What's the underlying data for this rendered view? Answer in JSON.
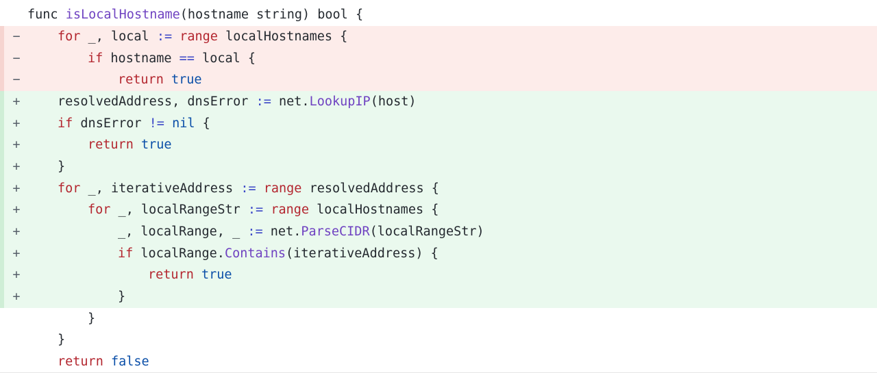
{
  "diff": {
    "lines": [
      {
        "type": "context",
        "marker": "",
        "indent": 0,
        "tokens": [
          {
            "t": "func ",
            "c": "plain"
          },
          {
            "t": "isLocalHostname",
            "c": "fn"
          },
          {
            "t": "(hostname string) bool {",
            "c": "plain"
          }
        ]
      },
      {
        "type": "removed",
        "marker": "−",
        "indent": 1,
        "tokens": [
          {
            "t": "for",
            "c": "kw"
          },
          {
            "t": " _, local ",
            "c": "plain"
          },
          {
            "t": ":=",
            "c": "op"
          },
          {
            "t": " ",
            "c": "plain"
          },
          {
            "t": "range",
            "c": "kw"
          },
          {
            "t": " localHostnames {",
            "c": "plain"
          }
        ]
      },
      {
        "type": "removed",
        "marker": "−",
        "indent": 2,
        "tokens": [
          {
            "t": "if",
            "c": "kw"
          },
          {
            "t": " hostname ",
            "c": "plain"
          },
          {
            "t": "==",
            "c": "op"
          },
          {
            "t": " local {",
            "c": "plain"
          }
        ]
      },
      {
        "type": "removed",
        "marker": "−",
        "indent": 3,
        "tokens": [
          {
            "t": "return",
            "c": "kw"
          },
          {
            "t": " ",
            "c": "plain"
          },
          {
            "t": "true",
            "c": "lit"
          }
        ]
      },
      {
        "type": "added",
        "marker": "+",
        "indent": 1,
        "tokens": [
          {
            "t": "resolvedAddress, dnsError ",
            "c": "plain"
          },
          {
            "t": ":=",
            "c": "op"
          },
          {
            "t": " net.",
            "c": "plain"
          },
          {
            "t": "LookupIP",
            "c": "fn"
          },
          {
            "t": "(host)",
            "c": "plain"
          }
        ]
      },
      {
        "type": "added",
        "marker": "+",
        "indent": 1,
        "tokens": [
          {
            "t": "if",
            "c": "kw"
          },
          {
            "t": " dnsError ",
            "c": "plain"
          },
          {
            "t": "!=",
            "c": "op"
          },
          {
            "t": " ",
            "c": "plain"
          },
          {
            "t": "nil",
            "c": "lit"
          },
          {
            "t": " {",
            "c": "plain"
          }
        ]
      },
      {
        "type": "added",
        "marker": "+",
        "indent": 2,
        "tokens": [
          {
            "t": "return",
            "c": "kw"
          },
          {
            "t": " ",
            "c": "plain"
          },
          {
            "t": "true",
            "c": "lit"
          }
        ]
      },
      {
        "type": "added",
        "marker": "+",
        "indent": 1,
        "tokens": [
          {
            "t": "}",
            "c": "plain"
          }
        ]
      },
      {
        "type": "added",
        "marker": "+",
        "indent": 1,
        "tokens": [
          {
            "t": "for",
            "c": "kw"
          },
          {
            "t": " _, iterativeAddress ",
            "c": "plain"
          },
          {
            "t": ":=",
            "c": "op"
          },
          {
            "t": " ",
            "c": "plain"
          },
          {
            "t": "range",
            "c": "kw"
          },
          {
            "t": " resolvedAddress {",
            "c": "plain"
          }
        ]
      },
      {
        "type": "added",
        "marker": "+",
        "indent": 2,
        "tokens": [
          {
            "t": "for",
            "c": "kw"
          },
          {
            "t": " _, localRangeStr ",
            "c": "plain"
          },
          {
            "t": ":=",
            "c": "op"
          },
          {
            "t": " ",
            "c": "plain"
          },
          {
            "t": "range",
            "c": "kw"
          },
          {
            "t": " localHostnames {",
            "c": "plain"
          }
        ]
      },
      {
        "type": "added",
        "marker": "+",
        "indent": 3,
        "tokens": [
          {
            "t": "_, localRange, _ ",
            "c": "plain"
          },
          {
            "t": ":=",
            "c": "op"
          },
          {
            "t": " net.",
            "c": "plain"
          },
          {
            "t": "ParseCIDR",
            "c": "fn"
          },
          {
            "t": "(localRangeStr)",
            "c": "plain"
          }
        ]
      },
      {
        "type": "added",
        "marker": "+",
        "indent": 3,
        "tokens": [
          {
            "t": "if",
            "c": "kw"
          },
          {
            "t": " localRange.",
            "c": "plain"
          },
          {
            "t": "Contains",
            "c": "fn"
          },
          {
            "t": "(iterativeAddress) {",
            "c": "plain"
          }
        ]
      },
      {
        "type": "added",
        "marker": "+",
        "indent": 4,
        "tokens": [
          {
            "t": "return",
            "c": "kw"
          },
          {
            "t": " ",
            "c": "plain"
          },
          {
            "t": "true",
            "c": "lit"
          }
        ]
      },
      {
        "type": "added",
        "marker": "+",
        "indent": 3,
        "tokens": [
          {
            "t": "}",
            "c": "plain"
          }
        ]
      },
      {
        "type": "context",
        "marker": "",
        "indent": 2,
        "tokens": [
          {
            "t": "}",
            "c": "plain"
          }
        ]
      },
      {
        "type": "context",
        "marker": "",
        "indent": 1,
        "tokens": [
          {
            "t": "}",
            "c": "plain"
          }
        ]
      },
      {
        "type": "context",
        "marker": "",
        "indent": 1,
        "tokens": [
          {
            "t": "return",
            "c": "kw"
          },
          {
            "t": " ",
            "c": "plain"
          },
          {
            "t": "false",
            "c": "lit"
          }
        ]
      }
    ]
  },
  "colors": {
    "removed_bg": "#fdecea",
    "added_bg": "#eaf9ee",
    "keyword": "#b3262f",
    "operator": "#3a46c7",
    "function": "#6f42c1",
    "literal": "#0b4fa8",
    "text": "#24292f"
  }
}
